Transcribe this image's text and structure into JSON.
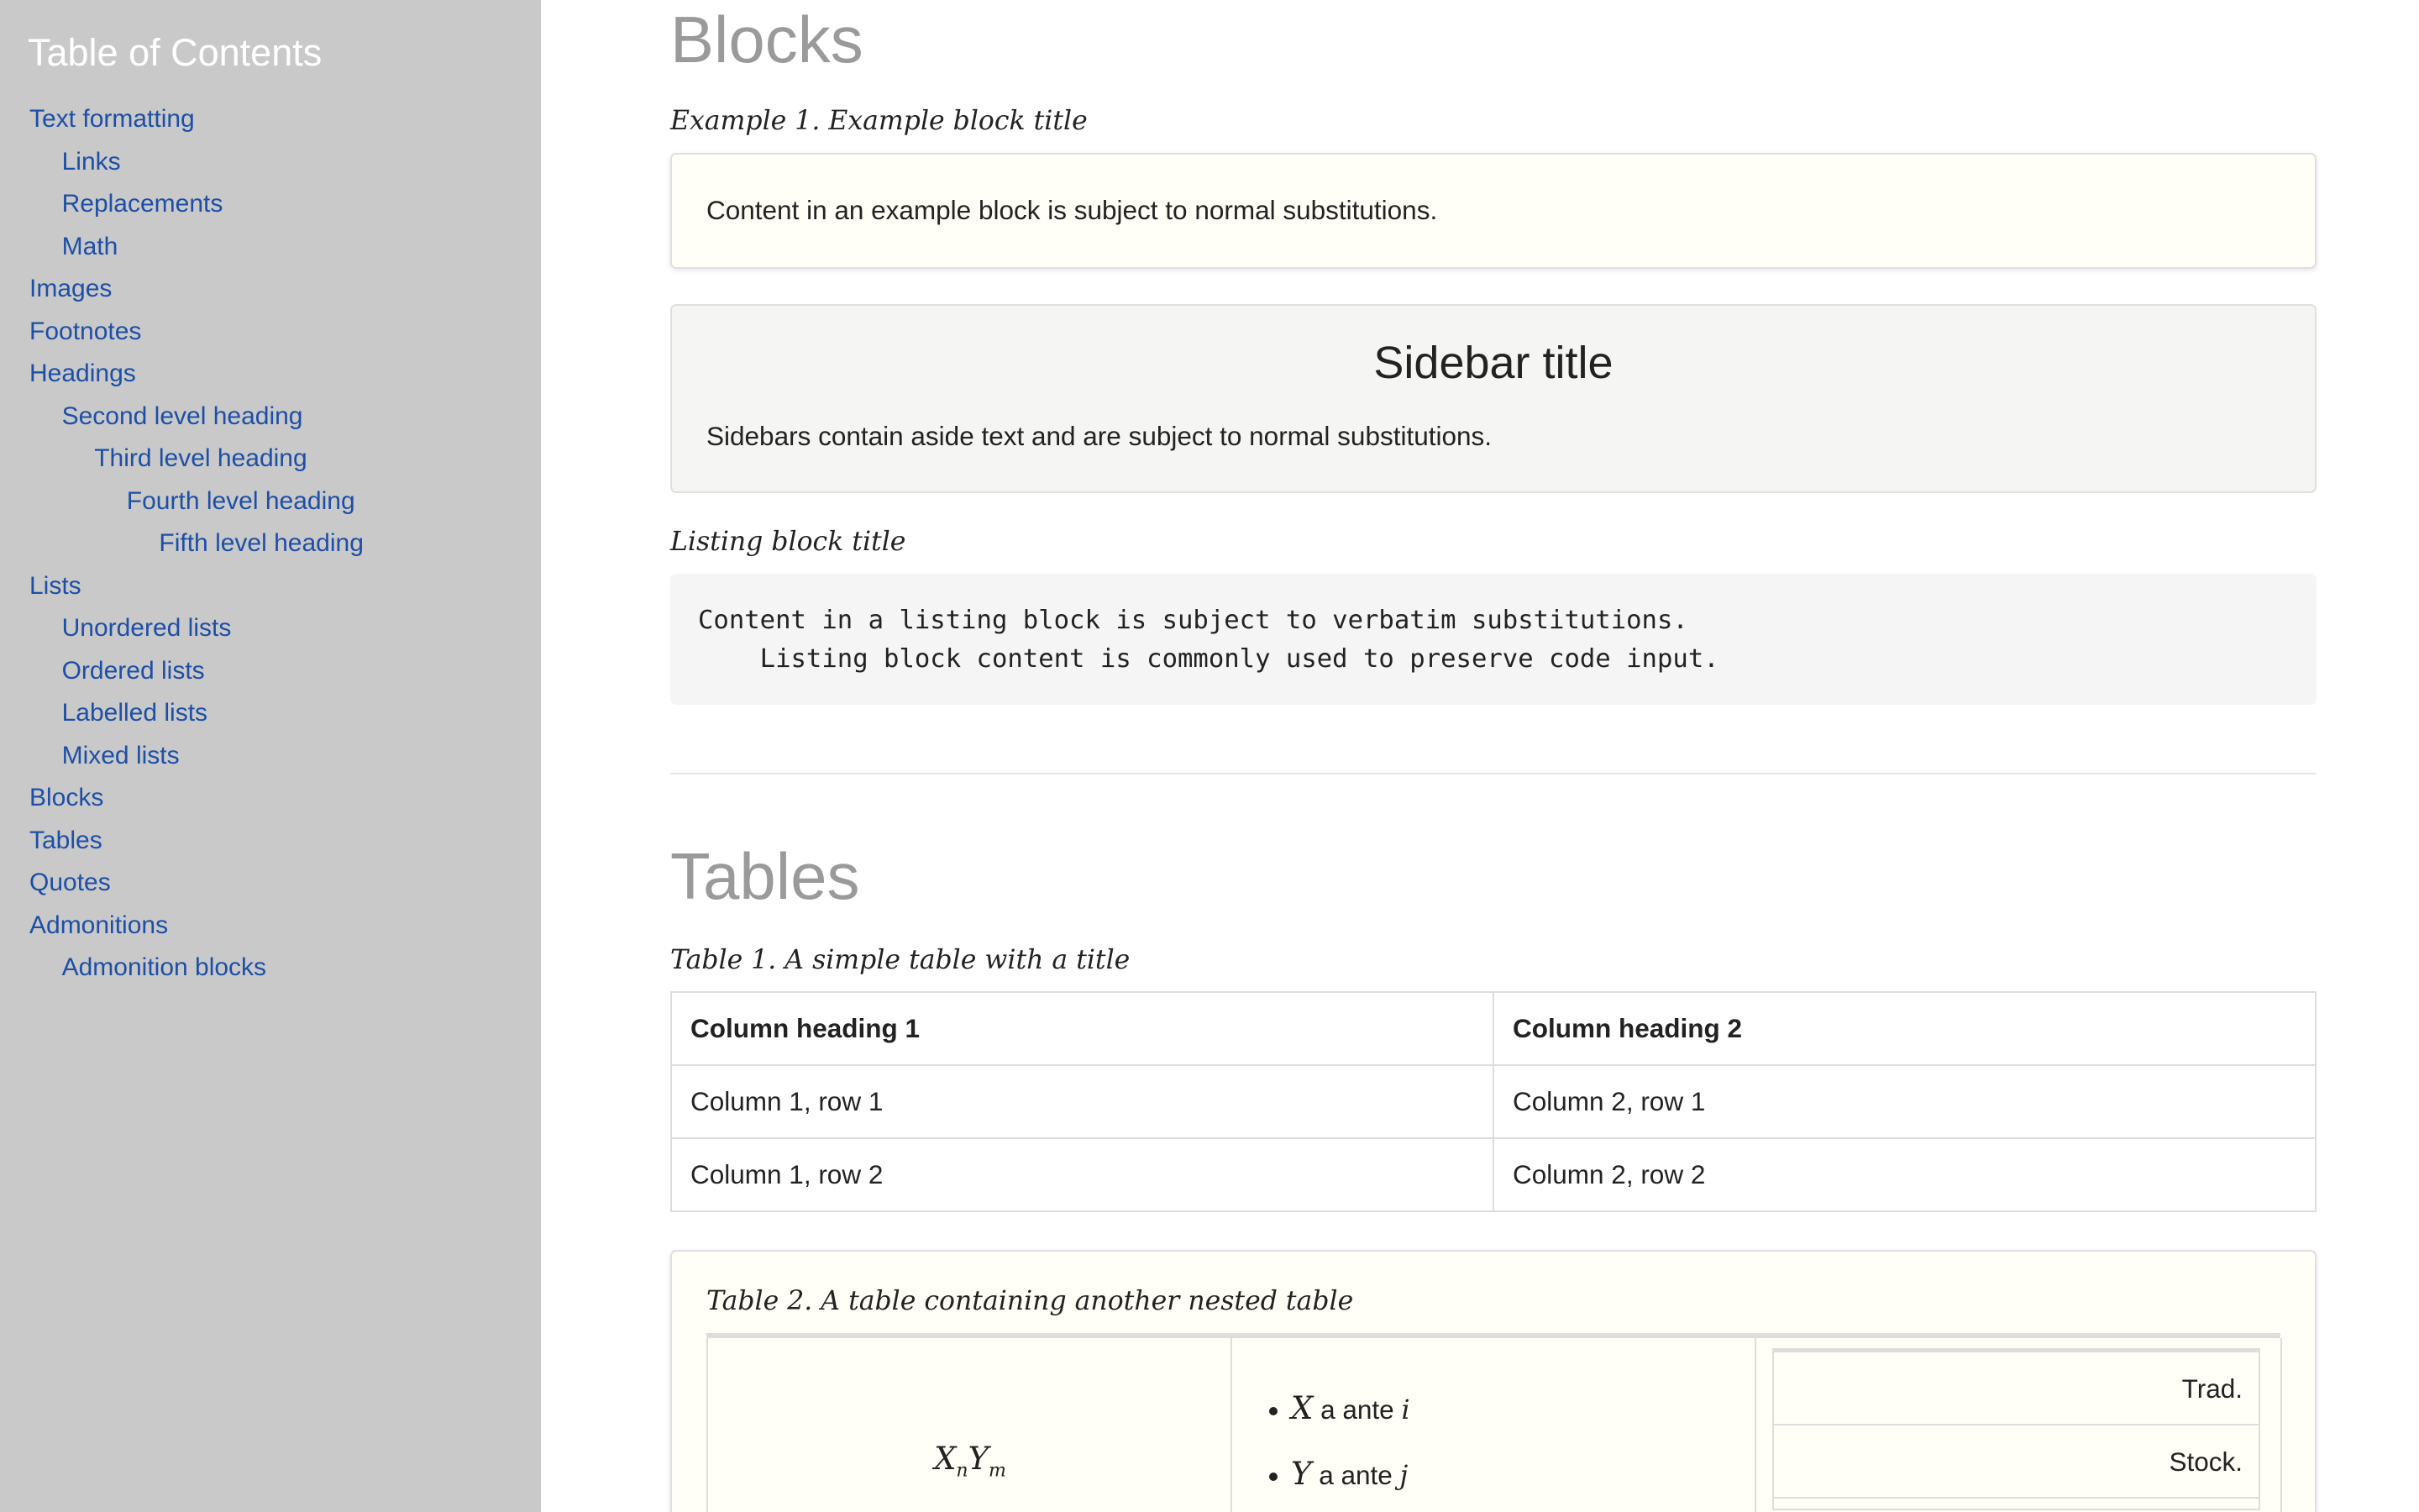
{
  "toc": {
    "title": "Table of Contents",
    "items": [
      {
        "label": "Text formatting",
        "level": 1
      },
      {
        "label": "Links",
        "level": 2
      },
      {
        "label": "Replacements",
        "level": 2
      },
      {
        "label": "Math",
        "level": 2
      },
      {
        "label": "Images",
        "level": 1
      },
      {
        "label": "Footnotes",
        "level": 1
      },
      {
        "label": "Headings",
        "level": 1
      },
      {
        "label": "Second level heading",
        "level": 2
      },
      {
        "label": "Third level heading",
        "level": 3
      },
      {
        "label": "Fourth level heading",
        "level": 4
      },
      {
        "label": "Fifth level heading",
        "level": 5
      },
      {
        "label": "Lists",
        "level": 1
      },
      {
        "label": "Unordered lists",
        "level": 2
      },
      {
        "label": "Ordered lists",
        "level": 2
      },
      {
        "label": "Labelled lists",
        "level": 2
      },
      {
        "label": "Mixed lists",
        "level": 2
      },
      {
        "label": "Blocks",
        "level": 1
      },
      {
        "label": "Tables",
        "level": 1
      },
      {
        "label": "Quotes",
        "level": 1
      },
      {
        "label": "Admonitions",
        "level": 1
      },
      {
        "label": "Admonition blocks",
        "level": 2
      }
    ]
  },
  "blocks": {
    "heading": "Blocks",
    "example_title": "Example 1. Example block title",
    "example_text": "Content in an example block is subject to normal substitutions.",
    "sidebar_title": "Sidebar title",
    "sidebar_text": "Sidebars contain aside text and are subject to normal substitutions.",
    "listing_title": "Listing block title",
    "listing_text": "Content in a listing block is subject to verbatim substitutions.\n    Listing block content is commonly used to preserve code input."
  },
  "tables": {
    "heading": "Tables",
    "table1": {
      "caption": "Table 1. A simple table with a title",
      "headers": [
        "Column heading 1",
        "Column heading 2"
      ],
      "rows": [
        [
          "Column 1, row 1",
          "Column 2, row 1"
        ],
        [
          "Column 1, row 2",
          "Column 2, row 2"
        ]
      ]
    },
    "table2": {
      "caption": "Table 2. A table containing another nested table",
      "math_x": "X",
      "math_n": "n",
      "math_y": "Y",
      "math_m": "m",
      "list": [
        {
          "var": "X",
          "text": " a ante ",
          "idx": "i"
        },
        {
          "var": "Y",
          "text": " a ante ",
          "idx": "j"
        }
      ],
      "inner_rows": [
        "Trad.",
        "Stock.",
        ""
      ]
    }
  }
}
